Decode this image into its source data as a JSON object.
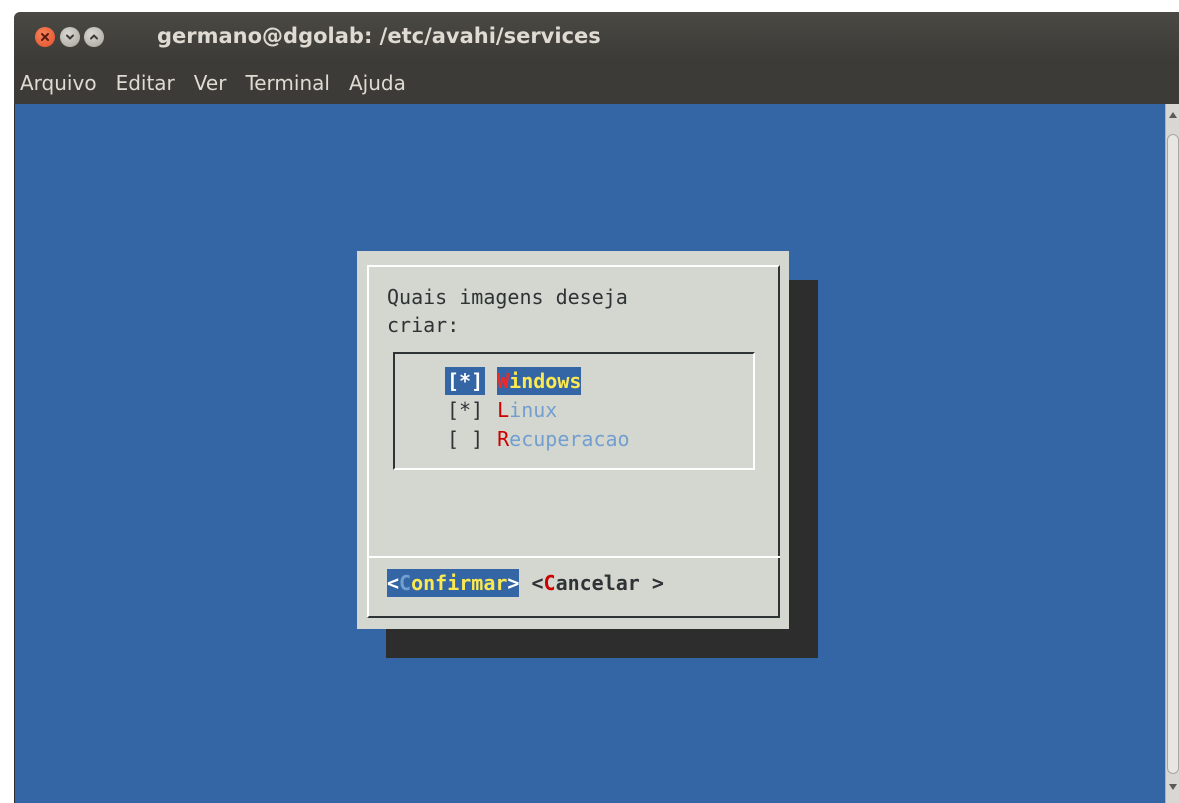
{
  "window": {
    "title": "germano@dgolab: /etc/avahi/services"
  },
  "menu": [
    "Arquivo",
    "Editar",
    "Ver",
    "Terminal",
    "Ajuda"
  ],
  "dialog": {
    "prompt_line1": "Quais imagens deseja",
    "prompt_line2": "criar:",
    "items": [
      {
        "box": "[*]",
        "hotkey": "W",
        "rest": "indows",
        "checked": true,
        "selected": true
      },
      {
        "box": "[*]",
        "hotkey": "L",
        "rest": "inux",
        "checked": true,
        "selected": false
      },
      {
        "box": "[ ]",
        "hotkey": "R",
        "rest": "ecuperacao",
        "checked": false,
        "selected": false
      }
    ],
    "confirm": {
      "open": "<",
      "hotkey": "C",
      "rest": "onfirmar",
      "close": ">"
    },
    "cancel": {
      "open": "<",
      "hotkey": "C",
      "rest": "ancelar",
      "close": " >"
    }
  },
  "colors": {
    "terminal_bg": "#3465a4",
    "dialog_bg": "#d3d7cf",
    "hotkey_red": "#cc0000",
    "highlight_yellow": "#fce94f",
    "titlebar": "#3c3b37"
  }
}
